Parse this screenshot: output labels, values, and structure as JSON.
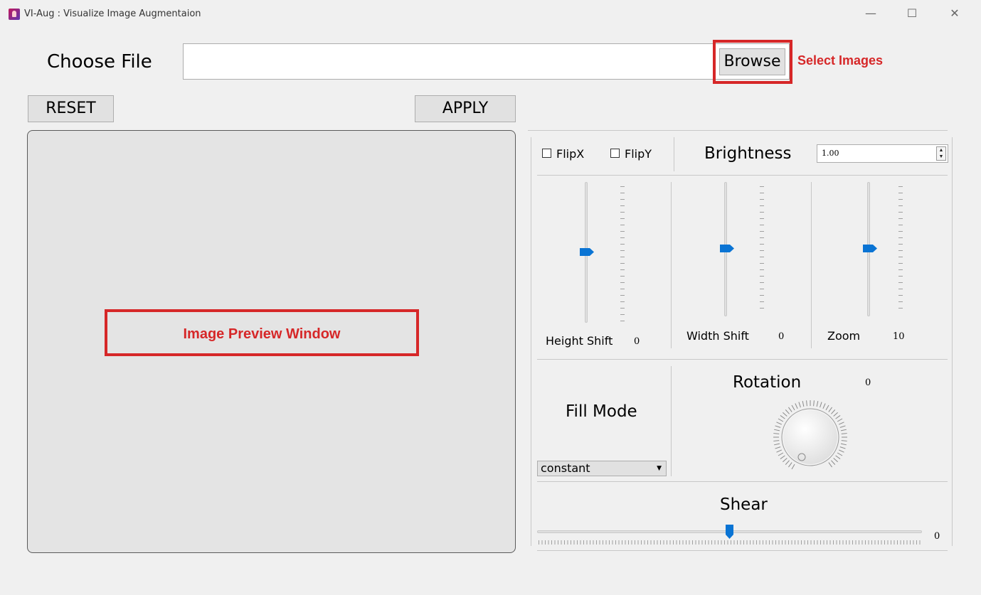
{
  "window": {
    "title": "VI-Aug : Visualize Image Augmentaion",
    "minimize_glyph": "—",
    "maximize_glyph": "☐",
    "close_glyph": "✕"
  },
  "file": {
    "label": "Choose File",
    "path_value": "",
    "browse_label": "Browse"
  },
  "actions": {
    "reset_label": "RESET",
    "apply_label": "APPLY"
  },
  "annotations": {
    "select_images": "Select Images",
    "preview_window": "Image Preview Window",
    "color": "#d62728"
  },
  "controls": {
    "flipx_label": "FlipX",
    "flipx_checked": false,
    "flipy_label": "FlipY",
    "flipy_checked": false,
    "brightness_label": "Brightness",
    "brightness_value": "1.00",
    "height_shift_label": "Height Shift",
    "height_shift_value": "0",
    "width_shift_label": "Width Shift",
    "width_shift_value": "0",
    "zoom_label": "Zoom",
    "zoom_value": "10",
    "fill_mode_label": "Fill Mode",
    "fill_mode_selected": "constant",
    "rotation_label": "Rotation",
    "rotation_value": "0",
    "shear_label": "Shear",
    "shear_value": "0"
  },
  "colors": {
    "slider_handle": "#0a74d4",
    "background": "#f0f0f0"
  }
}
